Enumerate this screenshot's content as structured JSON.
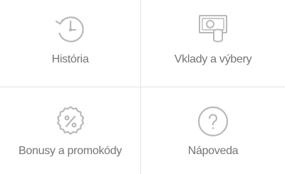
{
  "menu": {
    "items": [
      {
        "label": "História",
        "icon": "history-icon"
      },
      {
        "label": "Vklady a výbery",
        "icon": "deposit-withdraw-icon"
      },
      {
        "label": "Bonusy a promokódy",
        "icon": "bonus-percent-icon"
      },
      {
        "label": "Nápoveda",
        "icon": "help-icon"
      }
    ]
  },
  "colors": {
    "icon": "#b9b9b9",
    "text": "#757575",
    "divider": "#e3e3e3",
    "background": "#ffffff"
  }
}
